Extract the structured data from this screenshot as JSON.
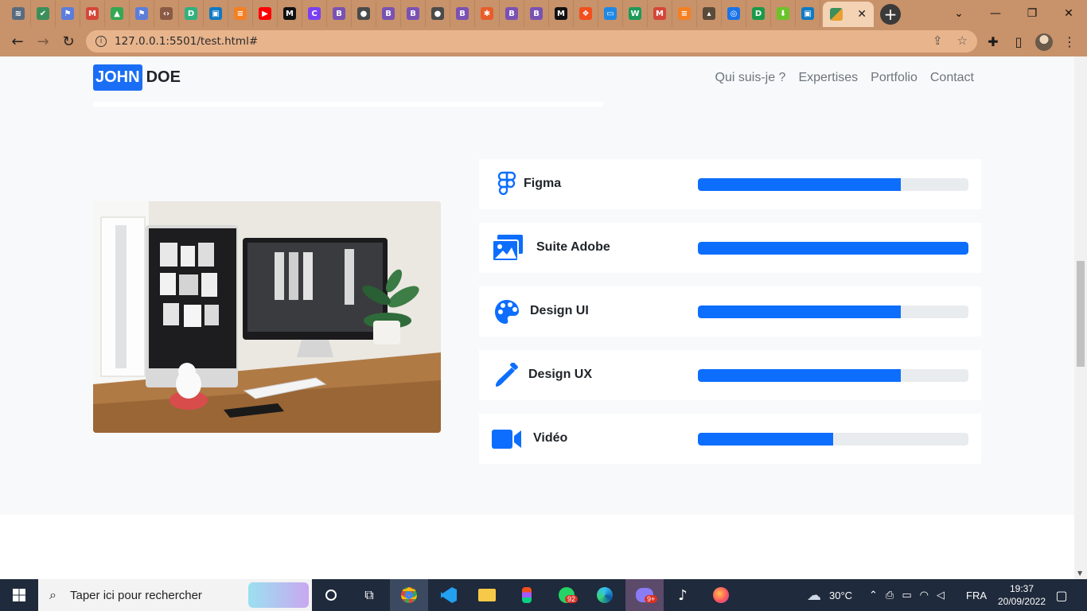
{
  "browser": {
    "url": "127.0.0.1:5501/test.html#",
    "tabs": [
      {
        "icon": "layers-icon",
        "color": "#5a6b7f",
        "glyph": "≋"
      },
      {
        "icon": "bookmark-icon",
        "color": "#3a8f5a",
        "glyph": "✔"
      },
      {
        "icon": "flag-icon",
        "color": "#5c7ddb",
        "glyph": "⚑"
      },
      {
        "icon": "gmail-icon",
        "color": "#d44638",
        "glyph": "M"
      },
      {
        "icon": "drive-icon",
        "color": "#34a853",
        "glyph": "▲"
      },
      {
        "icon": "flag-icon",
        "color": "#5c7ddb",
        "glyph": "⚑"
      },
      {
        "icon": "code-icon",
        "color": "#8a5a44",
        "glyph": "‹›"
      },
      {
        "icon": "d-icon",
        "color": "#2fb180",
        "glyph": "D"
      },
      {
        "icon": "tv-icon",
        "color": "#0f7ac2",
        "glyph": "▣"
      },
      {
        "icon": "stack-icon",
        "color": "#f48024",
        "glyph": "≡"
      },
      {
        "icon": "youtube-icon",
        "color": "#ff0000",
        "glyph": "▶"
      },
      {
        "icon": "medium-icon",
        "color": "#111111",
        "glyph": "M"
      },
      {
        "icon": "c-icon",
        "color": "#7b3ff2",
        "glyph": "C"
      },
      {
        "icon": "bootstrap-icon",
        "color": "#7952b3",
        "glyph": "B"
      },
      {
        "icon": "github-icon",
        "color": "#4a4a4a",
        "glyph": "●"
      },
      {
        "icon": "bootstrap-icon",
        "color": "#7952b3",
        "glyph": "B"
      },
      {
        "icon": "bootstrap-icon",
        "color": "#7952b3",
        "glyph": "B"
      },
      {
        "icon": "github-icon",
        "color": "#4a4a4a",
        "glyph": "●"
      },
      {
        "icon": "bootstrap-icon",
        "color": "#7952b3",
        "glyph": "B"
      },
      {
        "icon": "asterisk-icon",
        "color": "#e85d2a",
        "glyph": "✱"
      },
      {
        "icon": "bootstrap-icon",
        "color": "#7952b3",
        "glyph": "B"
      },
      {
        "icon": "bootstrap-icon",
        "color": "#7952b3",
        "glyph": "B"
      },
      {
        "icon": "medium-icon",
        "color": "#111111",
        "glyph": "M"
      },
      {
        "icon": "figma-icon",
        "color": "#f24e1e",
        "glyph": "❖"
      },
      {
        "icon": "window-icon",
        "color": "#1e88e5",
        "glyph": "▭"
      },
      {
        "icon": "w-icon",
        "color": "#1c9a5a",
        "glyph": "W"
      },
      {
        "icon": "gmail-icon",
        "color": "#d44638",
        "glyph": "M"
      },
      {
        "icon": "stack-icon",
        "color": "#f48024",
        "glyph": "≡"
      },
      {
        "icon": "hat-icon",
        "color": "#5a4a3a",
        "glyph": "▴"
      },
      {
        "icon": "target-icon",
        "color": "#1a73e8",
        "glyph": "◎"
      },
      {
        "icon": "d-icon",
        "color": "#1a9a4a",
        "glyph": "D"
      },
      {
        "icon": "download-icon",
        "color": "#6ac32a",
        "glyph": "⬇"
      },
      {
        "icon": "tv-icon",
        "color": "#0f7ac2",
        "glyph": "▣"
      }
    ]
  },
  "site": {
    "brand_first": "JOHN",
    "brand_last": "DOE",
    "nav": [
      "Qui suis-je ?",
      "Expertises",
      "Portfolio",
      "Contact"
    ],
    "skills": [
      {
        "label": "Figma",
        "level": 0.75,
        "icon": "figma-icon"
      },
      {
        "label": "Suite Adobe",
        "level": 1.0,
        "icon": "images-icon"
      },
      {
        "label": "Design UI",
        "level": 0.75,
        "icon": "palette-icon"
      },
      {
        "label": "Design UX",
        "level": 0.75,
        "icon": "eyedropper-icon"
      },
      {
        "label": "Vidéo",
        "level": 0.5,
        "icon": "video-camera-icon"
      }
    ],
    "accent": "#0d6efd"
  },
  "taskbar": {
    "search_placeholder": "Taper ici pour rechercher",
    "weather": "30°C",
    "language": "FRA",
    "time": "19:37",
    "date": "20/09/2022",
    "whatsapp_badge": "92",
    "discord_badge": "9+"
  }
}
